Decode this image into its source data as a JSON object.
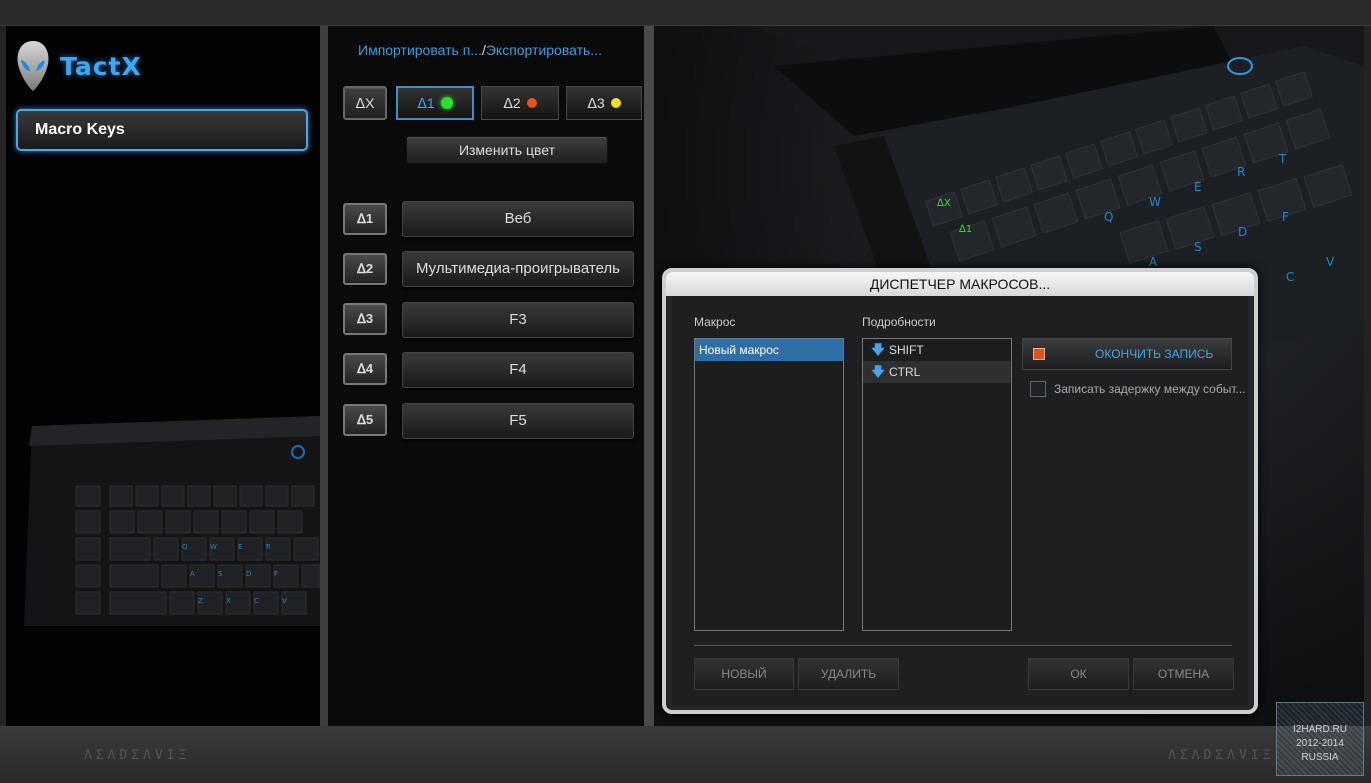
{
  "app": {
    "brand": "TactX"
  },
  "sidebar": {
    "macro_keys_label": "Macro Keys"
  },
  "middle": {
    "import_label": "Импортировать п...",
    "separator": "/",
    "export_label": "Экспортировать...",
    "mx_label": "ᐃX",
    "profiles": [
      {
        "label": "ᐃ1",
        "dot_color": "#2ee02e"
      },
      {
        "label": "ᐃ2",
        "dot_color": "#e8511e"
      },
      {
        "label": "ᐃ3",
        "dot_color": "#f0e020"
      }
    ],
    "change_color_label": "Изменить цвет",
    "macro_keys": [
      {
        "key": "ᐃ1",
        "value": "Веб"
      },
      {
        "key": "ᐃ2",
        "value": "Мультимедиа-проигрыватель"
      },
      {
        "key": "ᐃ3",
        "value": "F3"
      },
      {
        "key": "ᐃ4",
        "value": "F4"
      },
      {
        "key": "ᐃ5",
        "value": "F5"
      }
    ]
  },
  "dialog": {
    "title": "ДИСПЕТЧЕР МАКРОСОВ...",
    "macro_header": "Макрос",
    "details_header": "Подробности",
    "macros": [
      "Новый макрос"
    ],
    "details": [
      "SHIFT",
      "CTRL"
    ],
    "stop_record_label": "ОКОНЧИТЬ ЗАПИСЬ",
    "record_delay_label": "Записать задержку между событ...",
    "new_label": "НОВЫЙ",
    "delete_label": "УДАЛИТЬ",
    "ok_label": "ОК",
    "cancel_label": "ОТМЕНА"
  },
  "footer": {
    "left_mark": "ΛΣΛDΣΛVΙΞ",
    "right_mark": "ΛΣΛDΣΛVΙΞ"
  },
  "watermark": {
    "line1": "I2HARD.RU",
    "line2": "2012-2014",
    "line3": "RUSSIA"
  }
}
